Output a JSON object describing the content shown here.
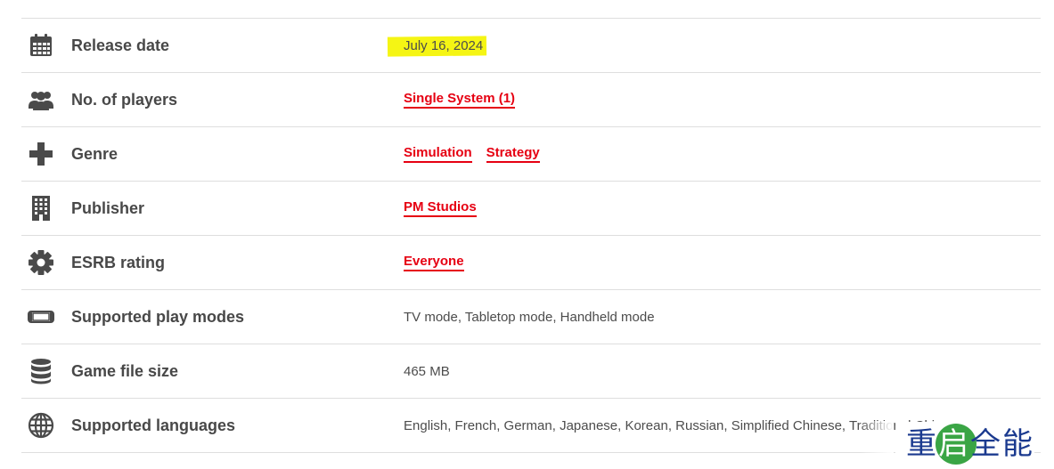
{
  "rows": [
    {
      "icon": "calendar-icon",
      "label": "Release date",
      "value": "July 16, 2024"
    },
    {
      "icon": "players-icon",
      "label": "No. of players",
      "links": [
        "Single System (1)"
      ]
    },
    {
      "icon": "dpad-icon",
      "label": "Genre",
      "links": [
        "Simulation",
        "Strategy"
      ]
    },
    {
      "icon": "building-icon",
      "label": "Publisher",
      "links": [
        "PM Studios"
      ]
    },
    {
      "icon": "gear-icon",
      "label": "ESRB rating",
      "links": [
        "Everyone"
      ]
    },
    {
      "icon": "console-icon",
      "label": "Supported play modes",
      "value": "TV mode, Tabletop mode, Handheld mode"
    },
    {
      "icon": "database-icon",
      "label": "Game file size",
      "value": "465 MB"
    },
    {
      "icon": "globe-icon",
      "label": "Supported languages",
      "value": "English, French, German, Japanese, Korean, Russian, Simplified Chinese, Traditional Chinese"
    }
  ],
  "watermark": {
    "chars": [
      "重",
      "启",
      "全",
      "能"
    ]
  },
  "colors": {
    "link": "#e60012",
    "highlight": "#f5f514",
    "icon": "#4a4a4a",
    "watermark_text": "#1b3a8f",
    "watermark_circle": "#3aa545"
  }
}
